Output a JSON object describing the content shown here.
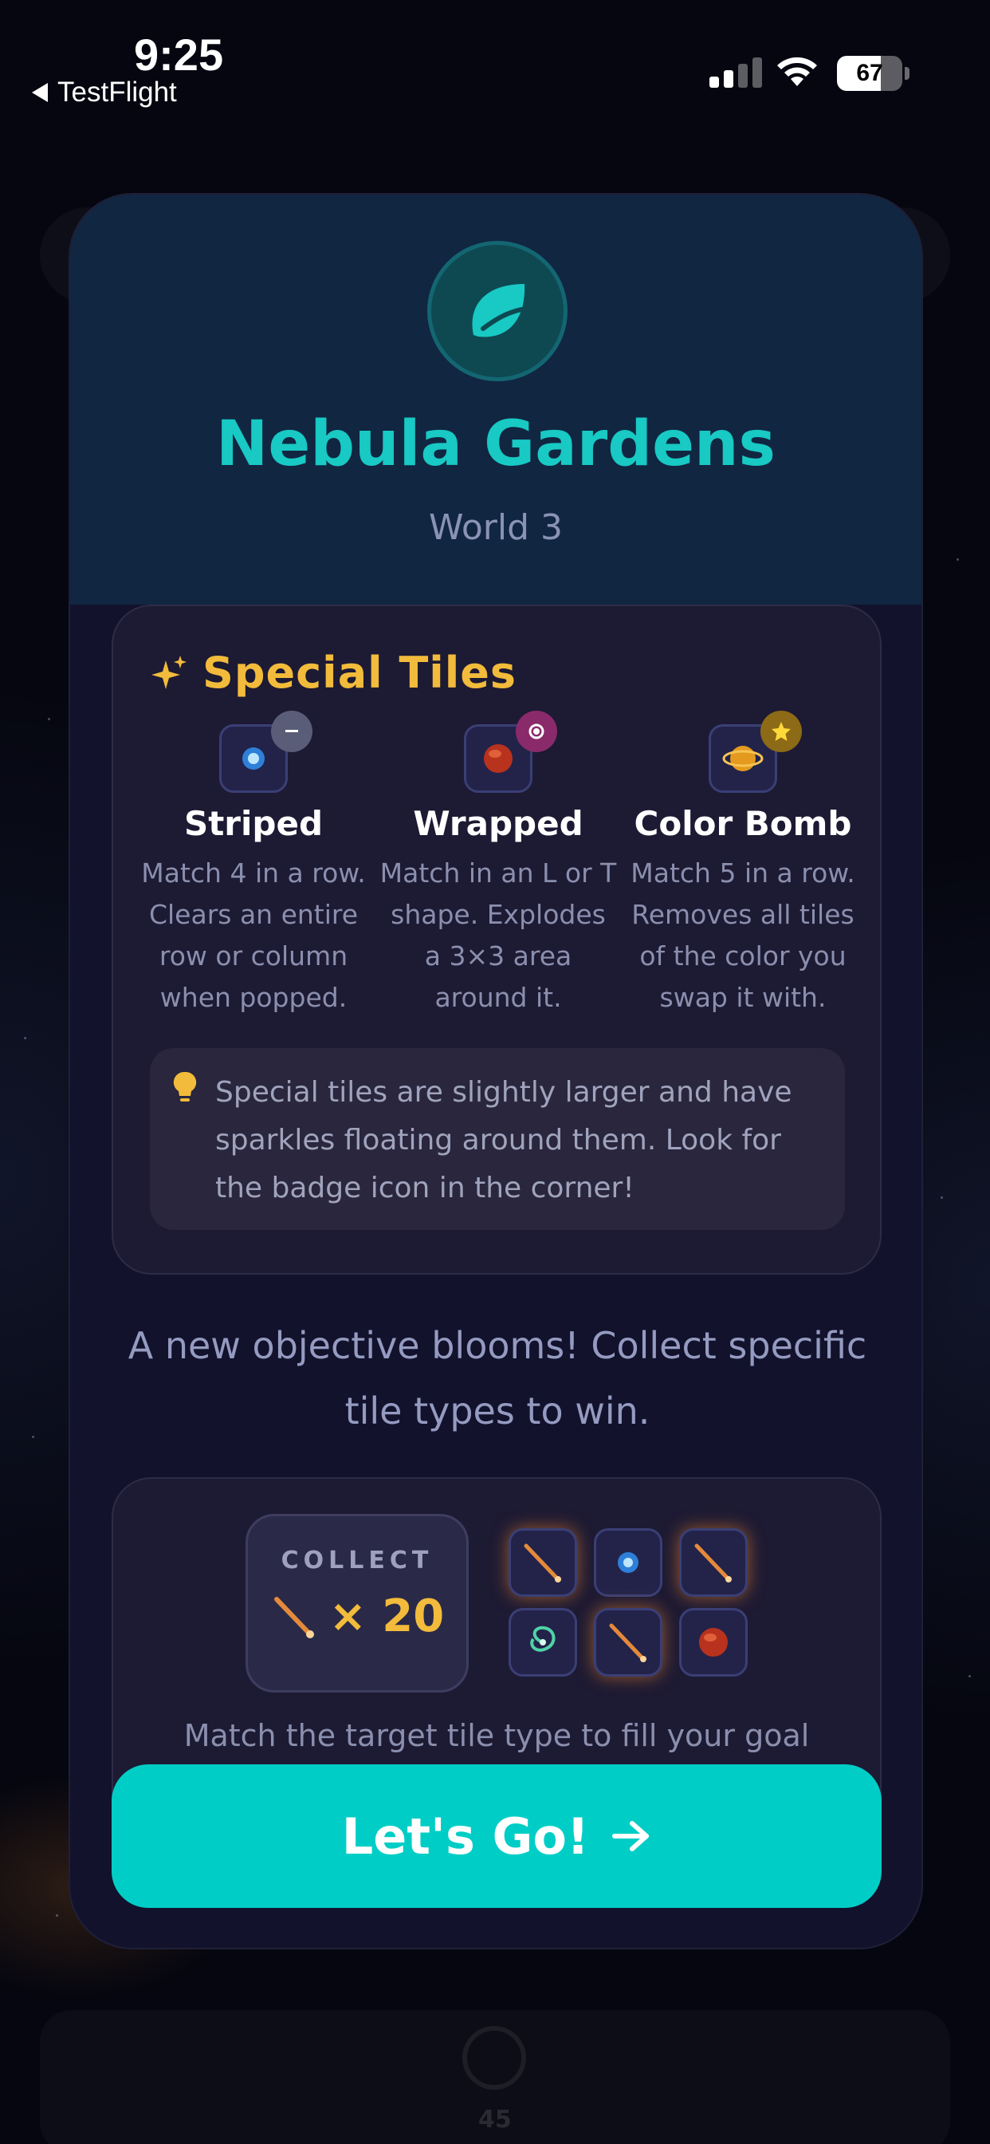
{
  "status_bar": {
    "time": "9:25",
    "back_app": "TestFlight",
    "battery": "67"
  },
  "world": {
    "icon": "leaf-icon",
    "title": "Nebula Gardens",
    "subtitle": "World 3",
    "accent_color": "#18c9c4"
  },
  "special_tiles": {
    "title": "Special Tiles",
    "title_icon": "sparkles-icon",
    "items": [
      {
        "name": "Striped",
        "description": "Match 4 in a row. Clears an entire row or column when popped.",
        "badge_icon": "line-badge-icon"
      },
      {
        "name": "Wrapped",
        "description": "Match in an L or T shape. Explodes a 3×3 area around it.",
        "badge_icon": "ring-badge-icon"
      },
      {
        "name": "Color Bomb",
        "description": "Match 5 in a row. Removes all tiles of the color you swap it with.",
        "badge_icon": "star-badge-icon"
      }
    ],
    "tip": "Special tiles are slightly larger and have sparkles floating around them. Look for the badge icon in the corner!",
    "tip_icon": "lightbulb-icon"
  },
  "objective": {
    "intro": "A new objective blooms! Collect specific tile types to win.",
    "collect_label": "COLLECT",
    "collect_count": "× 20",
    "collect_icon": "comet-icon",
    "grid_icons": [
      "comet-icon",
      "blue-star-icon",
      "comet-icon",
      "galaxy-icon",
      "comet-icon",
      "red-planet-icon"
    ],
    "hint": "Match the target tile type to fill your goal"
  },
  "cta": {
    "label": "Let's Go!",
    "icon": "arrow-right-icon",
    "color": "#00cec6"
  },
  "background": {
    "number": "45"
  }
}
